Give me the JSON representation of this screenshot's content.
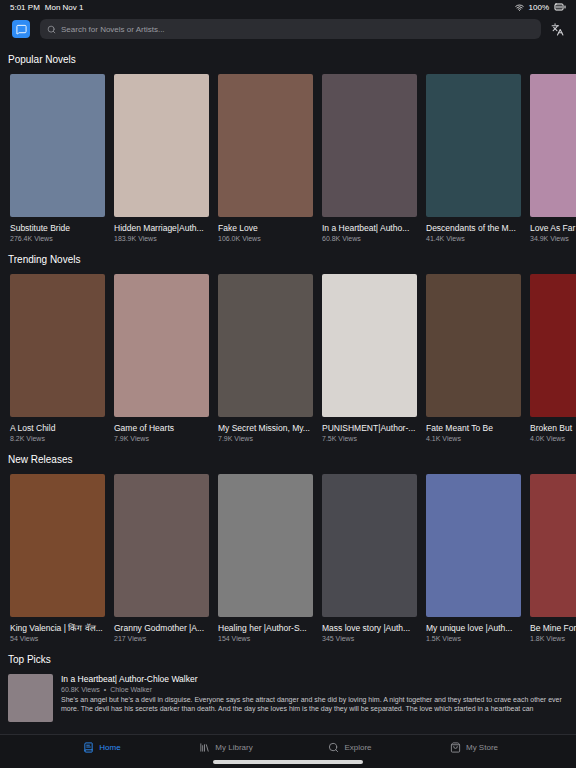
{
  "status_bar": {
    "time": "5:01 PM",
    "date": "Mon Nov 1",
    "battery": "100%"
  },
  "search": {
    "placeholder": "Search for Novels or Artists..."
  },
  "sections": [
    {
      "title": "Popular Novels",
      "items": [
        {
          "title": "Substitute Bride",
          "views": "276.4K Views"
        },
        {
          "title": "Hidden Marriage|Auth...",
          "views": "183.9K Views"
        },
        {
          "title": "Fake Love",
          "views": "106.0K Views"
        },
        {
          "title": "In a Heartbeat| Autho...",
          "views": "60.8K Views"
        },
        {
          "title": "Descendants of the M...",
          "views": "41.4K Views"
        },
        {
          "title": "Love As Far",
          "views": "34.9K Views"
        }
      ]
    },
    {
      "title": "Trending Novels",
      "items": [
        {
          "title": "A Lost Child",
          "views": "8.2K Views"
        },
        {
          "title": "Game of Hearts",
          "views": "7.9K Views"
        },
        {
          "title": "My Secret Mission, My...",
          "views": "7.9K Views"
        },
        {
          "title": "PUNISHMENT|Author-...",
          "views": "7.5K Views"
        },
        {
          "title": "Fate Meant To Be",
          "views": "4.1K Views"
        },
        {
          "title": "Broken But",
          "views": "4.0K Views"
        }
      ]
    },
    {
      "title": "New Releases",
      "items": [
        {
          "title": "King Valencia | किंग वॅल...",
          "views": "54 Views"
        },
        {
          "title": "Granny Godmother |A...",
          "views": "217 Views"
        },
        {
          "title": "Healing her |Author-S...",
          "views": "154 Views"
        },
        {
          "title": "Mass love story |Auth...",
          "views": "345 Views"
        },
        {
          "title": "My unique love |Auth...",
          "views": "1.5K Views"
        },
        {
          "title": "Be Mine For",
          "views": "1.8K Views"
        }
      ]
    }
  ],
  "top_picks": {
    "title": "Top Picks",
    "items": [
      {
        "title": "In a Heartbeat| Author-Chloe Walker",
        "views": "60.8K Views",
        "separator": "•",
        "author": "Chloe Walker",
        "description": "She's an angel but he's a devil in disguise. Everyone says she attract danger and she did by loving him. A night together and they started to crave each other ever more. The devil has his secrets darker than death. And the day she loves him is the day they will be separated. The love which started in a heartbeat can"
      }
    ]
  },
  "tabs": [
    {
      "label": "Home",
      "selected": true
    },
    {
      "label": "My Library",
      "selected": false
    },
    {
      "label": "Explore",
      "selected": false
    },
    {
      "label": "My Store",
      "selected": false
    }
  ]
}
